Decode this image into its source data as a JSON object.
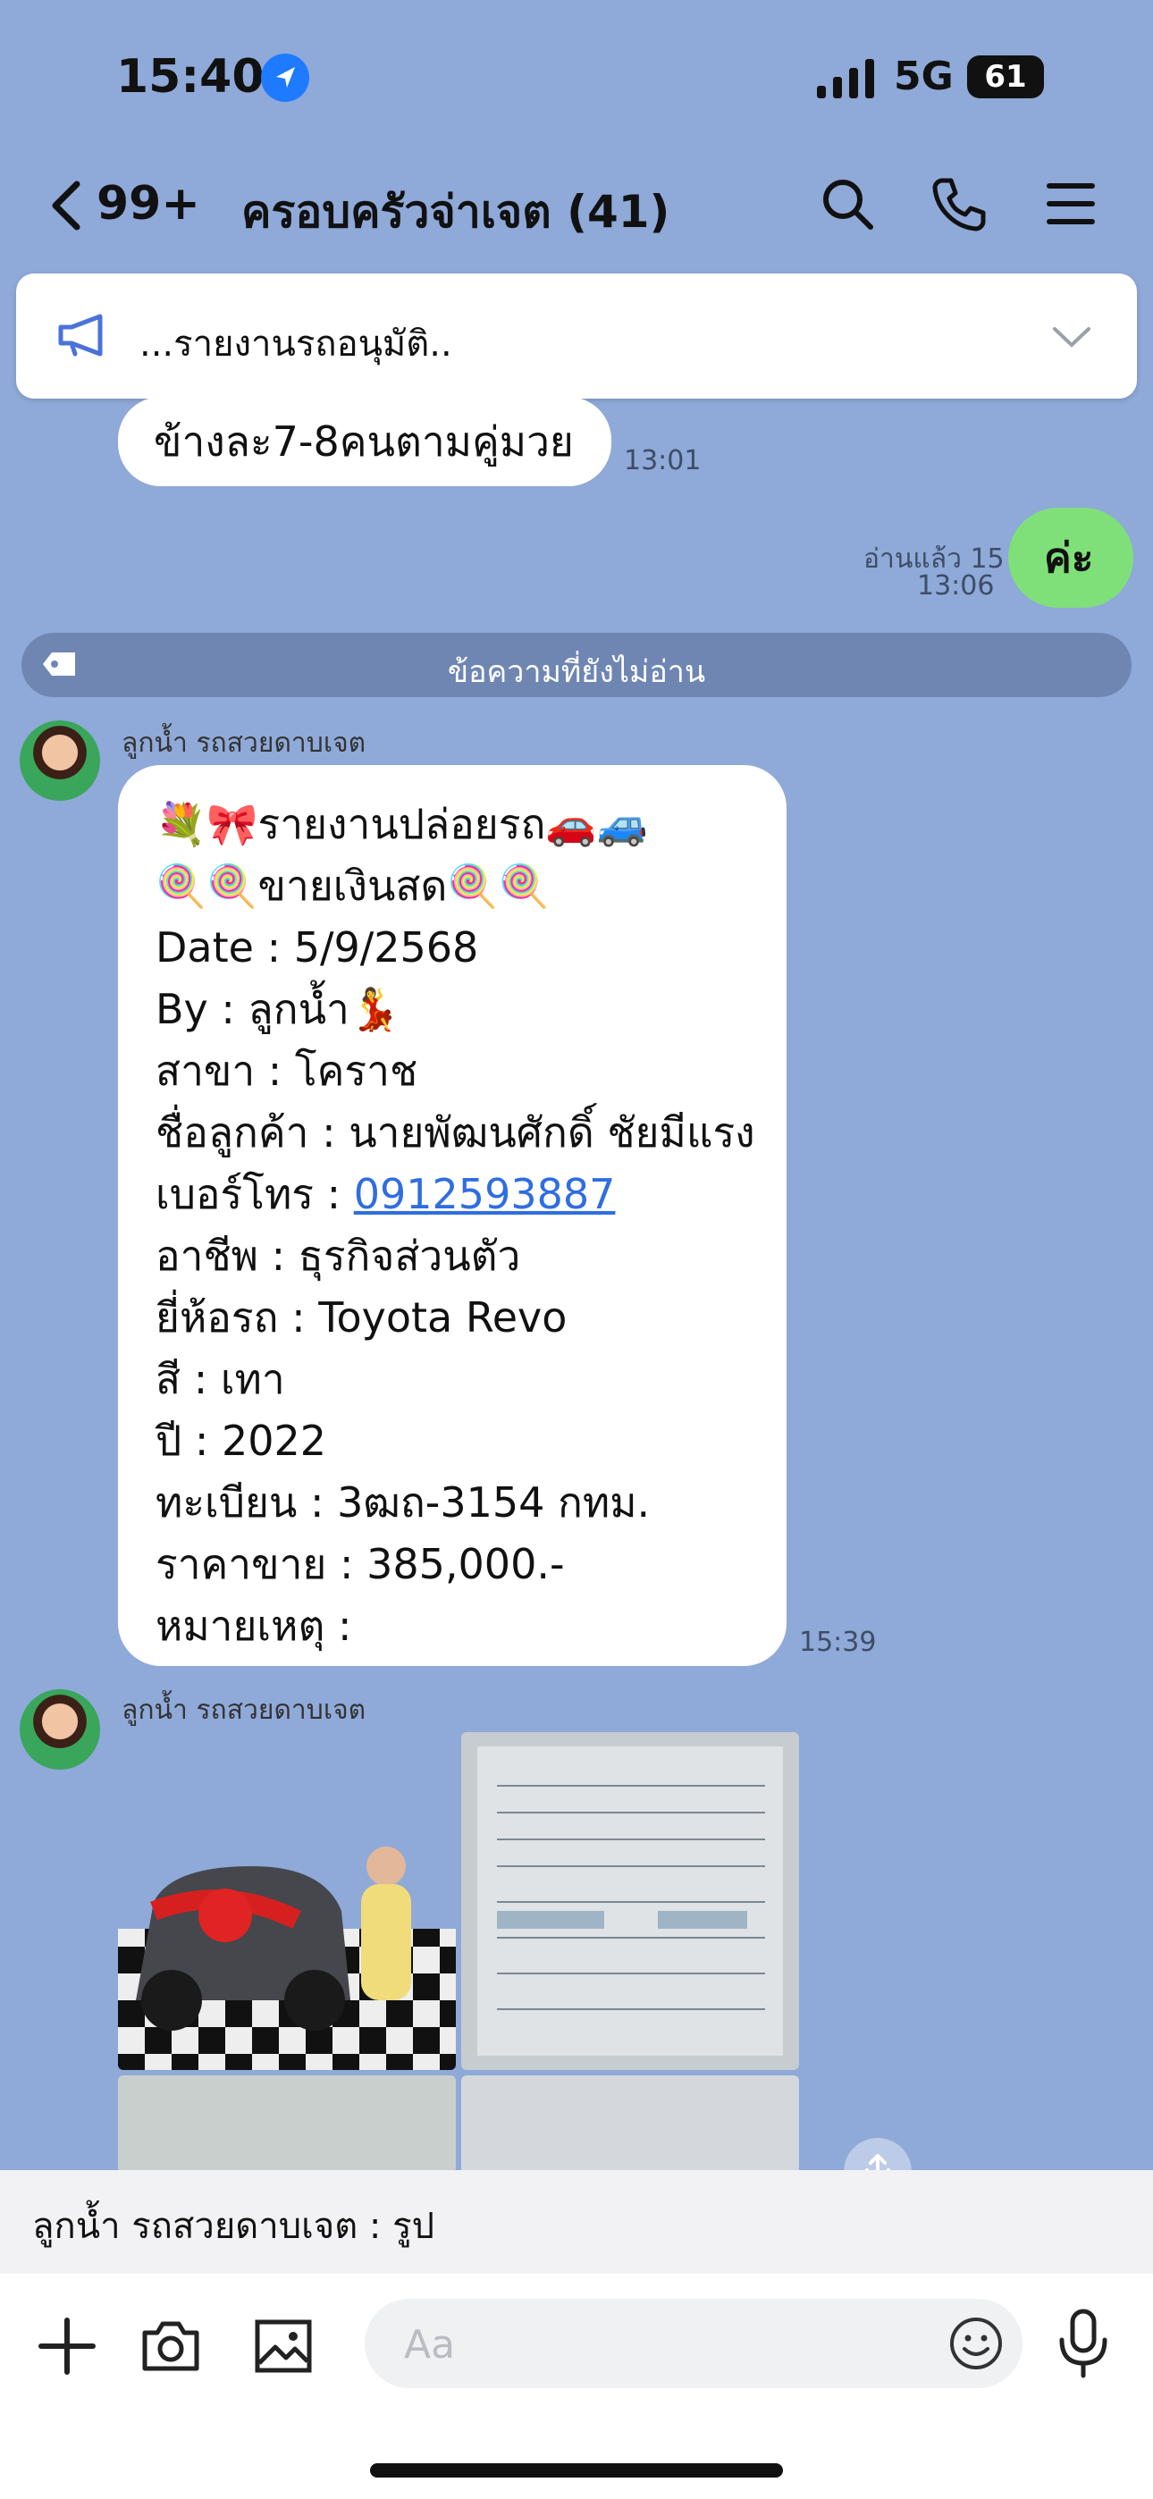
{
  "status": {
    "time": "15:40",
    "network": "5G",
    "battery": "61"
  },
  "header": {
    "back_count": "99+",
    "title": "ครอบครัวจ่าเจต (41)"
  },
  "announcement": {
    "text": "...รายงานรถอนุมัติ.."
  },
  "messages": {
    "m1": {
      "text": "ข้างละ7-8คนตามคู่มวย",
      "time": "13:01"
    },
    "m2": {
      "text": "ค่ะ",
      "read": "อ่านแล้ว 15",
      "time": "13:06"
    },
    "unread": "ข้อความที่ยังไม่อ่าน",
    "m3": {
      "sender": "ลูกน้ำ รถสวยดาบเจต",
      "lines": [
        "💐🎀รายงานปล่อยรถ🚗🚙",
        "🍭🍭ขายเงินสด🍭🍭",
        "Date : 5/9/2568",
        "By : ลูกน้ำ💃",
        "สาขา : โคราช",
        "ชื่อลูกค้า : นายพัฒนศักดิ์ ชัยมีแรง",
        "เบอร์โทร : ",
        "อาชีพ : ธุรกิจส่วนตัว",
        "ยี่ห้อรถ : Toyota Revo",
        "สี : เทา",
        "ปี : 2022",
        "ทะเบียน : 3ฒถ-3154 กทม.",
        "ราคาขาย : 385,000.-",
        "หมายเหตุ :"
      ],
      "phone": "0912593887",
      "time": "15:39"
    },
    "m4": {
      "sender": "ลูกน้ำ รถสวยดาบเจต"
    }
  },
  "preview": {
    "text": "ลูกน้ำ รถสวยดาบเจต : รูป"
  },
  "input": {
    "placeholder": "Aa"
  },
  "colors": {
    "background": "#8fa9d8",
    "mine_bubble": "#7fe07a",
    "link": "#2f6de1"
  }
}
